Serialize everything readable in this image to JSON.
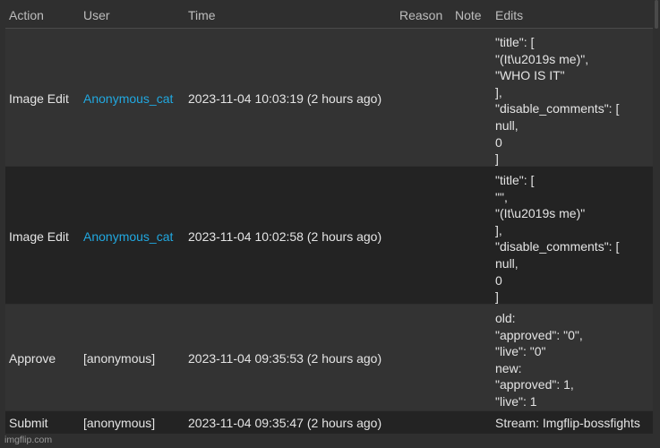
{
  "header": {
    "action": "Action",
    "user": "User",
    "time": "Time",
    "reason": "Reason",
    "note": "Note",
    "edits": "Edits"
  },
  "rows": [
    {
      "action": "Image Edit",
      "user": "Anonymous_cat",
      "time": "2023-11-04 10:03:19 (2 hours ago)",
      "edits": "\"title\": [\n\"(It\\u2019s me)\",\n\"WHO IS IT\"\n],\n\"disable_comments\": [\nnull,\n0\n]"
    },
    {
      "action": "Image Edit",
      "user": "Anonymous_cat",
      "time": "2023-11-04 10:02:58 (2 hours ago)",
      "edits": "\"title\": [\n\"\",\n\"(It\\u2019s me)\"\n],\n\"disable_comments\": [\nnull,\n0\n]"
    },
    {
      "action": "Approve",
      "user": "[anonymous]",
      "time": "2023-11-04 09:35:53 (2 hours ago)",
      "edits": "old:\n\"approved\": \"0\",\n\"live\": \"0\"\nnew:\n\"approved\": 1,\n\"live\": 1"
    },
    {
      "action": "Submit",
      "user": "[anonymous]",
      "time": "2023-11-04 09:35:47 (2 hours ago)",
      "edits": "Stream: Imgflip-bossfights"
    }
  ],
  "watermark": "imgflip.com",
  "colors": {
    "background": "#2f2f2f",
    "row_alt": "#232323",
    "link": "#21a8e0",
    "text": "#e4e4e4"
  }
}
